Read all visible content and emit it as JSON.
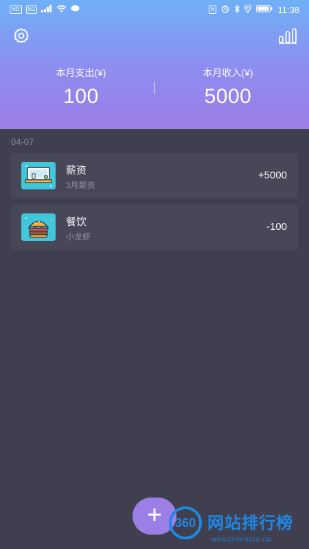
{
  "status_bar": {
    "left_tags": [
      "HD",
      "5G"
    ],
    "right_tags": [
      "N"
    ],
    "time": "11:38"
  },
  "header": {
    "settings_icon": "gear-icon",
    "stats_icon": "bar-chart-icon",
    "expense_label": "本月支出(¥)",
    "expense_value": "100",
    "income_label": "本月收入(¥)",
    "income_value": "5000",
    "gradient_colors": [
      "#6fb0f7",
      "#9b7ee6"
    ]
  },
  "list": {
    "date": "04-07",
    "items": [
      {
        "title": "薪资",
        "note": "3月薪资",
        "amount": "+5000",
        "icon": "salary-icon"
      },
      {
        "title": "餐饮",
        "note": "小龙虾",
        "amount": "-100",
        "icon": "burger-icon"
      }
    ]
  },
  "fab": {
    "icon": "plus-icon",
    "color": "#9b7ee6"
  },
  "watermark": {
    "logo": "360",
    "text": "网站排行榜",
    "sub": "WANGZHAN360.CN"
  }
}
